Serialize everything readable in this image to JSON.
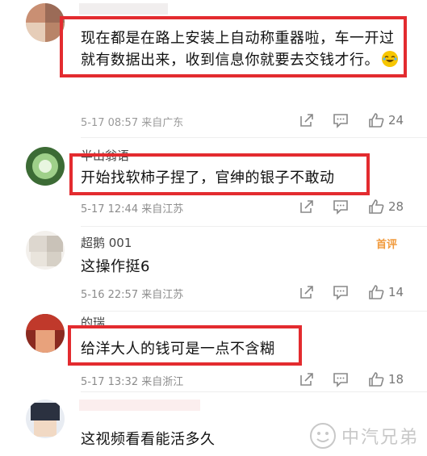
{
  "comments": [
    {
      "username": "",
      "text": "现在都是在路上安装上自动称重器啦，车一开过",
      "text2": "就有数据出来，收到信息你就要去交钱才行。",
      "meta": "5-17 08:57 来自广东",
      "likes": "24"
    },
    {
      "username": "半山翁语",
      "text": "开始找软柿子捏了，官绅的银子不敢动",
      "meta": "5-17 12:44 来自江苏",
      "likes": "28"
    },
    {
      "username": "超鹅 001",
      "badge": "首评",
      "text": "这操作挺6",
      "meta": "5-16 22:57 来自江苏",
      "likes": "14"
    },
    {
      "username": "的瑞",
      "text": "给洋大人的钱可是一点不含糊",
      "meta": "5-17 13:32 来自浙江",
      "likes": "18"
    },
    {
      "username": "",
      "text": "这视频看看能活多久",
      "meta": "",
      "likes": ""
    }
  ],
  "watermark": "中汽兄弟",
  "colors": {
    "highlight": "#e32b2f",
    "meta": "#8c8c8c",
    "badge": "#f19a3c"
  }
}
